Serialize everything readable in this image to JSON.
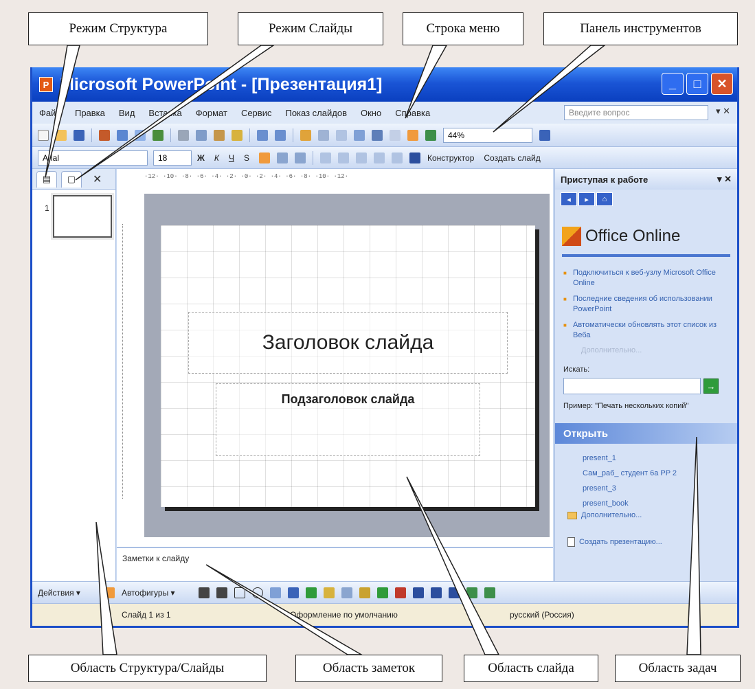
{
  "callouts": {
    "outline_mode": "Режим Структура",
    "slides_mode": "Режим Слайды",
    "menu_bar": "Строка меню",
    "toolbar": "Панель инструментов",
    "outline_slides_area": "Область Структура/Слайды",
    "notes_area": "Область заметок",
    "slide_area": "Область слайда",
    "task_area": "Область задач"
  },
  "window": {
    "title": "Microsoft PowerPoint - [Презентация1]",
    "minimize": "_",
    "maximize": "□",
    "close": "✕"
  },
  "menu": {
    "items": [
      "Файл",
      "Правка",
      "Вид",
      "Вставка",
      "Формат",
      "Сервис",
      "Показ слайдов",
      "Окно",
      "Справка"
    ],
    "help_placeholder": "Введите вопрос",
    "close": "▾ ✕"
  },
  "standard_toolbar": {
    "zoom": "44%"
  },
  "format_toolbar": {
    "font_name": "Arial",
    "font_size": "18",
    "designer": "Конструктор",
    "new_slide": "Создать слайд"
  },
  "left_pane": {
    "tab_outline": "▤",
    "tab_slides": "▢",
    "close": "✕",
    "slide_number": "1"
  },
  "ruler": {
    "h_text": "·12·  ·10·  ·8·  ·6·  ·4·  ·2·  ·0·  ·2·  ·4·  ·6·  ·8·  ·10·  ·12·"
  },
  "slide": {
    "title": "Заголовок слайда",
    "subtitle": "Подзаголовок слайда"
  },
  "notes": {
    "placeholder": "Заметки к слайду"
  },
  "task_pane": {
    "header": "Приступая к работе",
    "header_ctrl": "▾ ✕",
    "nav": [
      "◂",
      "▸",
      "⌂"
    ],
    "brand": "Office Online",
    "links": [
      "Подключиться к веб-узлу Microsoft Office Online",
      "Последние сведения об использовании PowerPoint",
      "Автоматически обновлять этот список из Веба"
    ],
    "more": "Дополнительно...",
    "search_label": "Искать:",
    "search_go": "→",
    "example": "Пример: \"Печать нескольких копий\"",
    "open_header": "Открыть",
    "recent": [
      "present_1",
      "Сам_раб_ студент 6а PP 2",
      "present_3",
      "present_book"
    ],
    "open_more": "Дополнительно...",
    "create": "Создать презентацию..."
  },
  "draw_toolbar": {
    "actions": "Действия ▾",
    "autoshapes": "Автофигуры ▾"
  },
  "status": {
    "slide": "Слайд 1 из 1",
    "design": "Оформление по умолчанию",
    "language": "русский (Россия)"
  }
}
